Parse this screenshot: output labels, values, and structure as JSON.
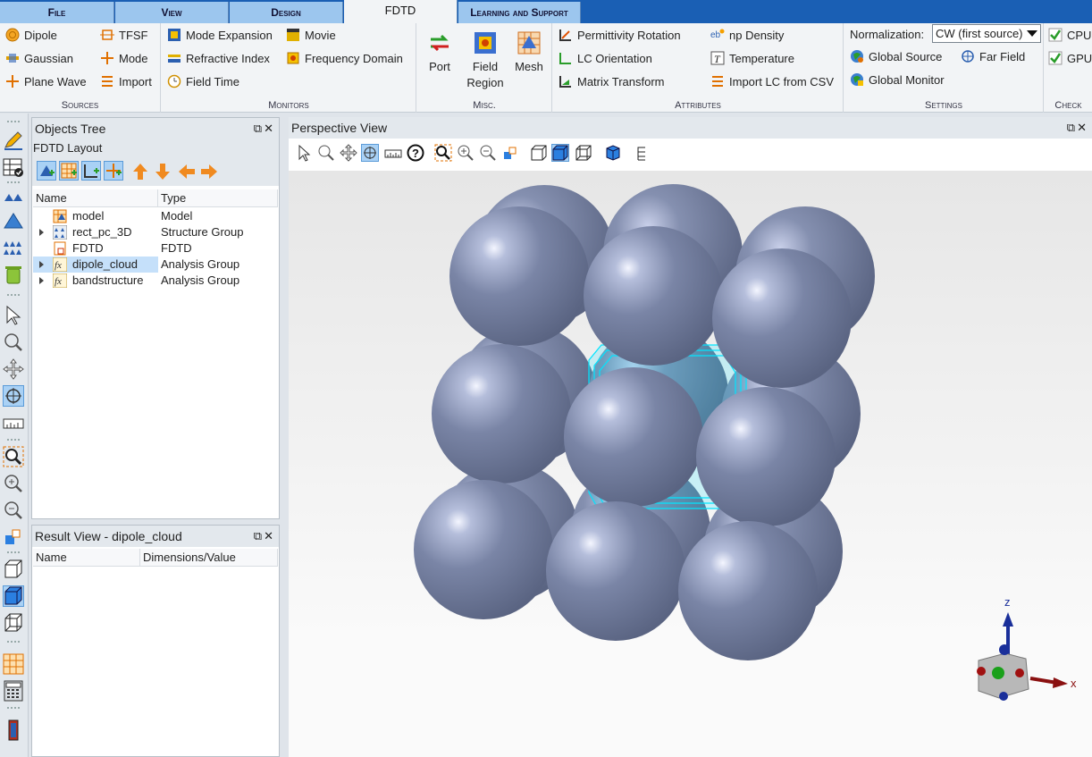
{
  "tabs": [
    {
      "label": "File",
      "active": false
    },
    {
      "label": "View",
      "active": false
    },
    {
      "label": "Design",
      "active": false
    },
    {
      "label": "FDTD",
      "active": true
    },
    {
      "label": "Learning and Support",
      "active": false
    }
  ],
  "ribbon": {
    "sources": {
      "title": "Sources",
      "items": [
        "Dipole",
        "TFSF",
        "Gaussian",
        "Mode",
        "Plane Wave",
        "Import"
      ]
    },
    "monitors": {
      "title": "Monitors",
      "items": [
        "Mode Expansion",
        "Movie",
        "Refractive Index",
        "Frequency Domain",
        "Field Time"
      ]
    },
    "misc": {
      "title": "Misc.",
      "port": "Port",
      "field_region_1": "Field",
      "field_region_2": "Region",
      "mesh": "Mesh"
    },
    "attributes": {
      "title": "Attributes",
      "items": [
        "Permittivity Rotation",
        "np Density",
        "LC Orientation",
        "Temperature",
        "Matrix Transform",
        "Import LC from CSV"
      ]
    },
    "settings": {
      "title": "Settings",
      "normalization_label": "Normalization:",
      "normalization_value": "CW (first source)",
      "global_source": "Global Source",
      "far_field": "Far Field",
      "global_monitor": "Global Monitor"
    },
    "check": {
      "title": "Check",
      "cpu": "CPU",
      "gpu": "GPU"
    }
  },
  "objects_tree": {
    "title": "Objects Tree",
    "layout_label": "FDTD Layout",
    "col_name": "Name",
    "col_type": "Type",
    "rows": [
      {
        "name": "model",
        "type": "Model",
        "icon": "model-icon",
        "expandable": false,
        "selected": false
      },
      {
        "name": "rect_pc_3D",
        "type": "Structure Group",
        "icon": "structure-group-icon",
        "expandable": true,
        "selected": false
      },
      {
        "name": "FDTD",
        "type": "FDTD",
        "icon": "fdtd-icon",
        "expandable": false,
        "selected": false
      },
      {
        "name": "dipole_cloud",
        "type": "Analysis Group",
        "icon": "analysis-group-icon",
        "expandable": true,
        "selected": true
      },
      {
        "name": "bandstructure",
        "type": "Analysis Group",
        "icon": "analysis-group-icon",
        "expandable": true,
        "selected": false
      }
    ]
  },
  "result_view": {
    "title": "Result View - dipole_cloud",
    "col_name": "Name",
    "col_value": "Dimensions/Value"
  },
  "perspective_view": {
    "title": "Perspective View",
    "axis_z": "z",
    "axis_x": "x"
  },
  "colors": {
    "tabbar": "#1a5fb4",
    "sphere": "#6e7898",
    "simulation_region": "#00e5ff",
    "selection": "#c5e0fa"
  }
}
